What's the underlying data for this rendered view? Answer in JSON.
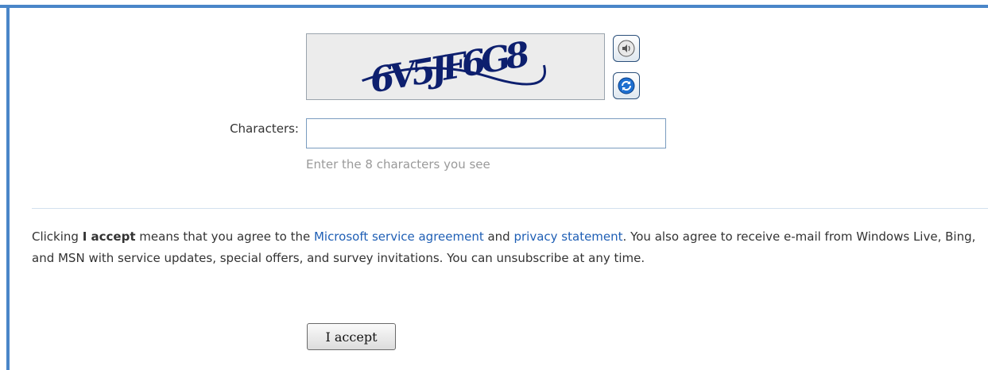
{
  "captcha": {
    "image_text": "6V5JF6G8",
    "audio_icon": "speaker-icon",
    "refresh_icon": "refresh-icon"
  },
  "form": {
    "characters_label": "Characters:",
    "characters_value": "",
    "characters_hint": "Enter the 8 characters you see"
  },
  "legal": {
    "prefix": "Clicking ",
    "accept_bold": "I accept",
    "middle": " means that you agree to the ",
    "link_service": "Microsoft service agreement",
    "and": " and ",
    "link_privacy": "privacy statement",
    "suffix": ".  You also agree to receive e-mail from Windows Live, Bing, and MSN with service updates, special offers, and survey invitations. You can unsubscribe at any time."
  },
  "actions": {
    "accept_label": "I accept"
  },
  "colors": {
    "frame": "#4a86c8",
    "link": "#1f5fb5",
    "captcha_ink": "#0d1f6e"
  }
}
